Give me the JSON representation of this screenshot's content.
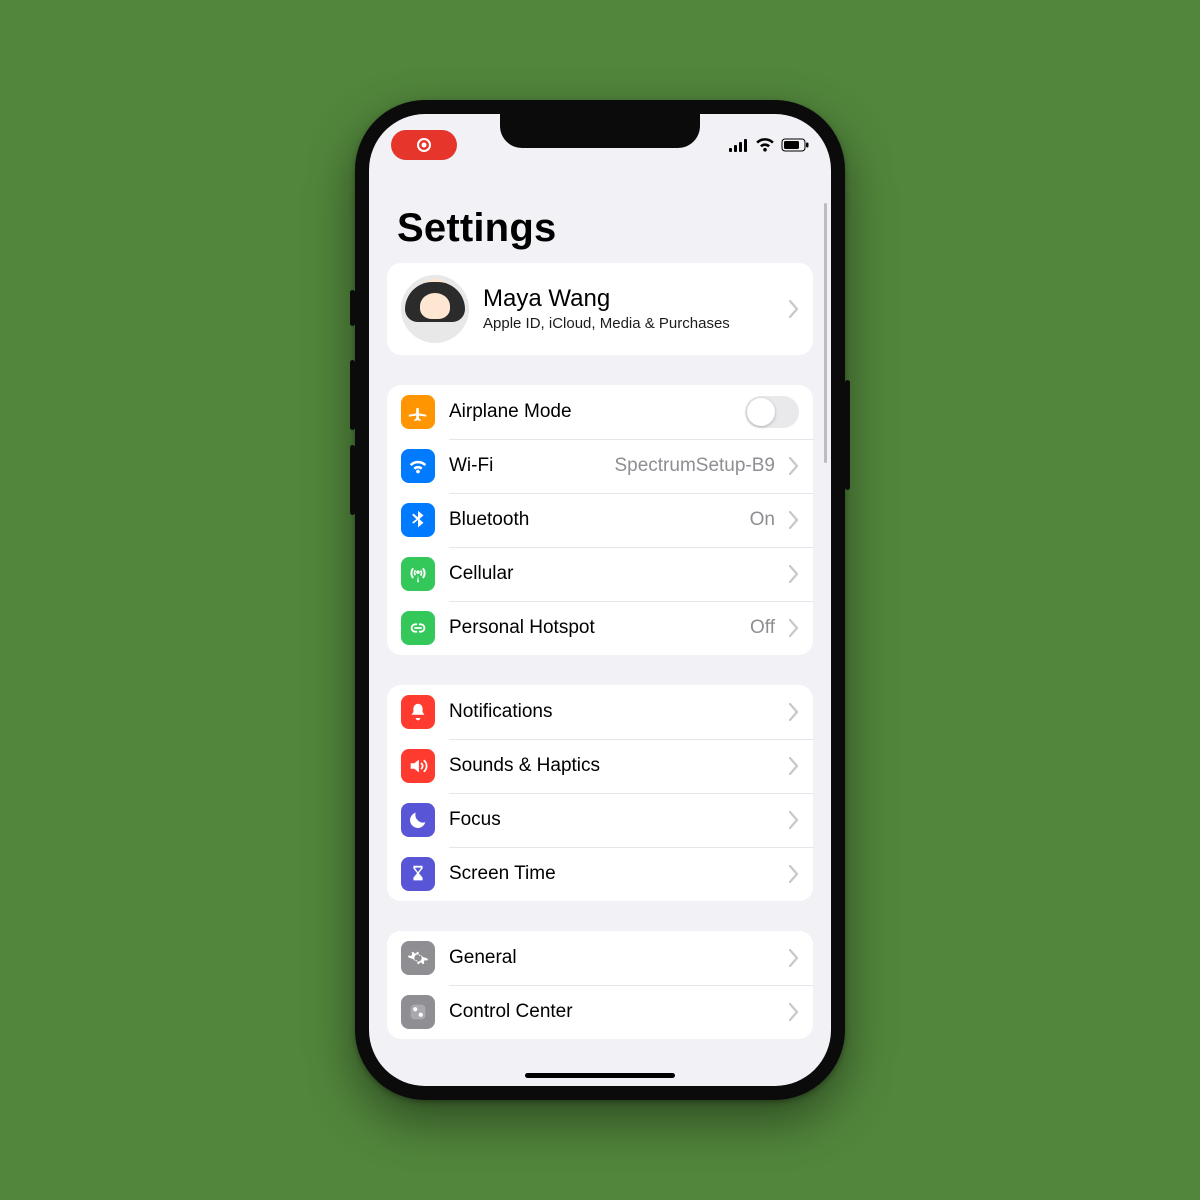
{
  "page": {
    "title": "Settings"
  },
  "profile": {
    "name": "Maya Wang",
    "subtitle": "Apple ID, iCloud, Media & Purchases"
  },
  "groups": [
    {
      "id": "connectivity",
      "rows": [
        {
          "id": "airplane",
          "label": "Airplane Mode",
          "type": "toggle",
          "value": "off",
          "icon": "airplane",
          "color": "orange"
        },
        {
          "id": "wifi",
          "label": "Wi-Fi",
          "type": "nav",
          "value": "SpectrumSetup-B9",
          "icon": "wifi",
          "color": "blue"
        },
        {
          "id": "bluetooth",
          "label": "Bluetooth",
          "type": "nav",
          "value": "On",
          "icon": "bluetooth",
          "color": "blue"
        },
        {
          "id": "cellular",
          "label": "Cellular",
          "type": "nav",
          "value": "",
          "icon": "antenna",
          "color": "green"
        },
        {
          "id": "hotspot",
          "label": "Personal Hotspot",
          "type": "nav",
          "value": "Off",
          "icon": "link",
          "color": "green"
        }
      ]
    },
    {
      "id": "notifications",
      "rows": [
        {
          "id": "notifications",
          "label": "Notifications",
          "type": "nav",
          "value": "",
          "icon": "bell",
          "color": "red"
        },
        {
          "id": "sounds",
          "label": "Sounds & Haptics",
          "type": "nav",
          "value": "",
          "icon": "speaker",
          "color": "red"
        },
        {
          "id": "focus",
          "label": "Focus",
          "type": "nav",
          "value": "",
          "icon": "moon",
          "color": "indigo"
        },
        {
          "id": "screentime",
          "label": "Screen Time",
          "type": "nav",
          "value": "",
          "icon": "hourglass",
          "color": "indigo"
        }
      ]
    },
    {
      "id": "general",
      "rows": [
        {
          "id": "general",
          "label": "General",
          "type": "nav",
          "value": "",
          "icon": "gear",
          "color": "gray"
        },
        {
          "id": "controlcenter",
          "label": "Control Center",
          "type": "nav",
          "value": "",
          "icon": "sliders",
          "color": "gray"
        }
      ]
    }
  ]
}
